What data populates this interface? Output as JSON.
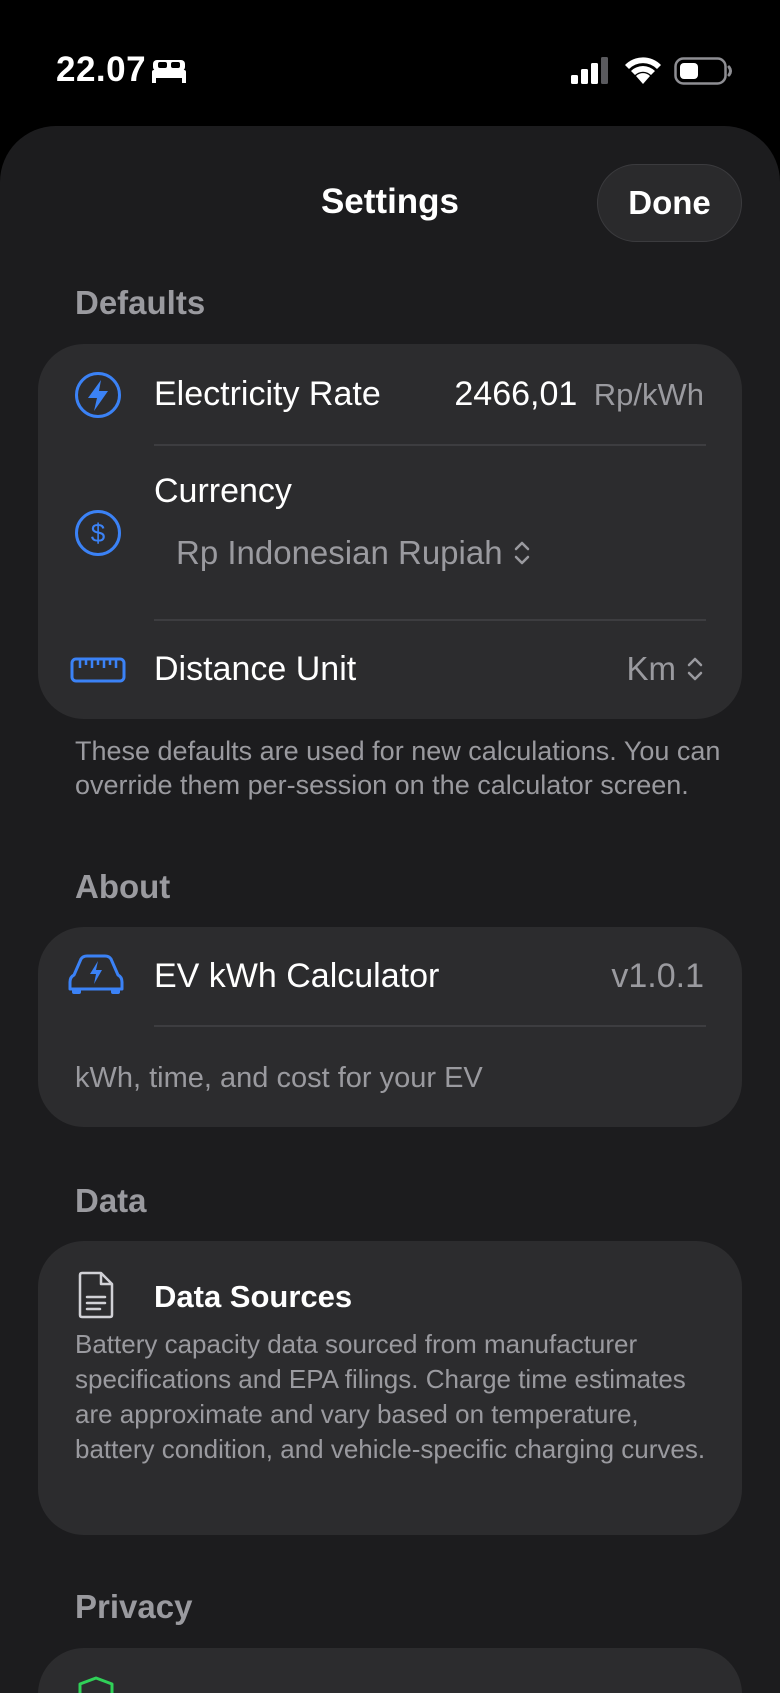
{
  "status_bar": {
    "time": "22.07",
    "sleep_icon": "bed-icon",
    "signal_icon": "cellular-signal-icon",
    "wifi_icon": "wifi-icon",
    "battery_icon": "battery-icon"
  },
  "header": {
    "title": "Settings",
    "done_label": "Done"
  },
  "defaults": {
    "section_title": "Defaults",
    "electricity_rate": {
      "icon": "bolt-circle-icon",
      "label": "Electricity Rate",
      "value": "2466,01",
      "unit": "Rp/kWh"
    },
    "currency": {
      "icon": "dollar-circle-icon",
      "label": "Currency",
      "value": "Rp Indonesian Rupiah"
    },
    "distance_unit": {
      "icon": "ruler-icon",
      "label": "Distance Unit",
      "value": "Km"
    },
    "footnote": "These defaults are used for new calculations. You can override them per-session on the calculator screen."
  },
  "about": {
    "section_title": "About",
    "app_icon": "ev-car-icon",
    "app_name": "EV kWh Calculator",
    "version": "v1.0.1",
    "description": "kWh, time, and cost for your EV"
  },
  "data_section": {
    "section_title": "Data",
    "icon": "document-icon",
    "title": "Data Sources",
    "body": "Battery capacity data sourced from manufacturer specifications and EPA filings. Charge time estimates are approximate and vary based on temperature, battery condition, and vehicle-specific charging curves."
  },
  "privacy": {
    "section_title": "Privacy",
    "icon": "shield-icon"
  },
  "colors": {
    "accent": "#3b82f6",
    "privacy_accent": "#30d158",
    "background": "#1c1c1e",
    "card": "#2c2c2e",
    "secondary_text": "#9a9a9f"
  }
}
